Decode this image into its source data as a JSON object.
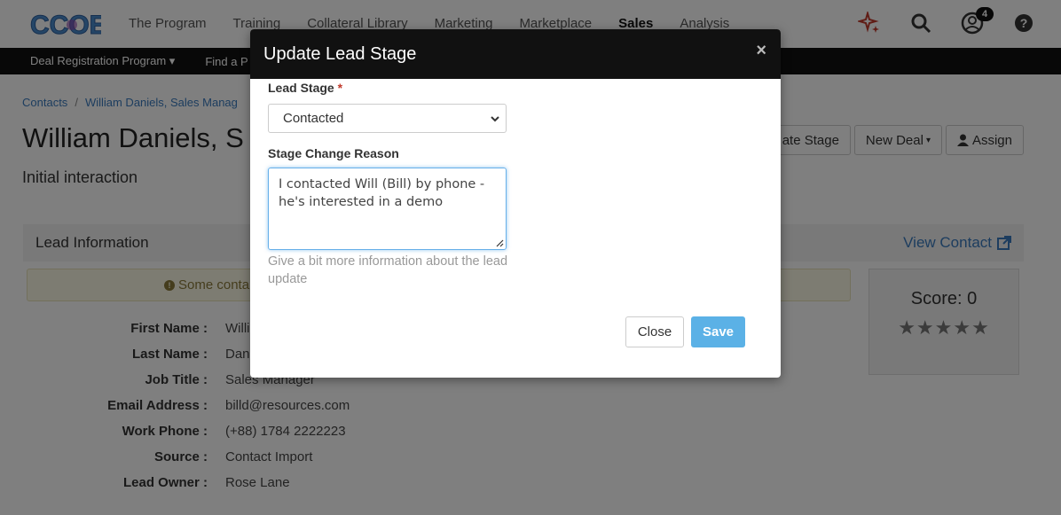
{
  "nav": {
    "logo_text": "CCOE",
    "links": [
      "The Program",
      "Training",
      "Collateral Library",
      "Marketing",
      "Marketplace",
      "Sales",
      "Analysis"
    ],
    "active": "Sales",
    "notification_count": "4",
    "icons": [
      "sparkle-icon",
      "search-icon",
      "user-icon",
      "help-icon"
    ]
  },
  "subnav": {
    "items": [
      "Deal Registration Program ▾",
      "Find a P"
    ]
  },
  "breadcrumb": [
    "Contacts",
    "William Daniels, Sales Manag"
  ],
  "page": {
    "title": "William Daniels, S",
    "subtitle": "Initial interaction"
  },
  "actions": {
    "update_stage": "ate Stage",
    "new_deal": "New Deal",
    "assign": "Assign"
  },
  "lead_info": {
    "title": "Lead Information",
    "view_contact": "View Contact",
    "warning": "Some conta"
  },
  "score": {
    "label": "Score: 0",
    "stars": "★★★★★",
    "rating": 0
  },
  "fields": [
    {
      "label": "First Name :",
      "value": "Willi"
    },
    {
      "label": "Last Name :",
      "value": "Dan"
    },
    {
      "label": "Job Title :",
      "value": "Sales Manager"
    },
    {
      "label": "Email Address :",
      "value": "billd@resources.com"
    },
    {
      "label": "Work Phone :",
      "value": "(+88) 1784 2222223"
    },
    {
      "label": "Source :",
      "value": "Contact Import"
    },
    {
      "label": "Lead Owner :",
      "value": "Rose Lane"
    }
  ],
  "modal": {
    "title": "Update Lead Stage",
    "close_x": "×",
    "lead_stage_label": "Lead Stage",
    "required_mark": "*",
    "lead_stage_value": "Contacted",
    "reason_label": "Stage Change Reason",
    "reason_value": "I contacted Will (Bill) by phone - he's interested in a demo",
    "help_text": "Give a bit more information about the lead update",
    "close_button": "Close",
    "save_button": "Save"
  },
  "colors": {
    "accent": "#5bb1e6",
    "link": "#3a7bbf",
    "dark_bar": "#111111",
    "required": "#c0392b"
  }
}
